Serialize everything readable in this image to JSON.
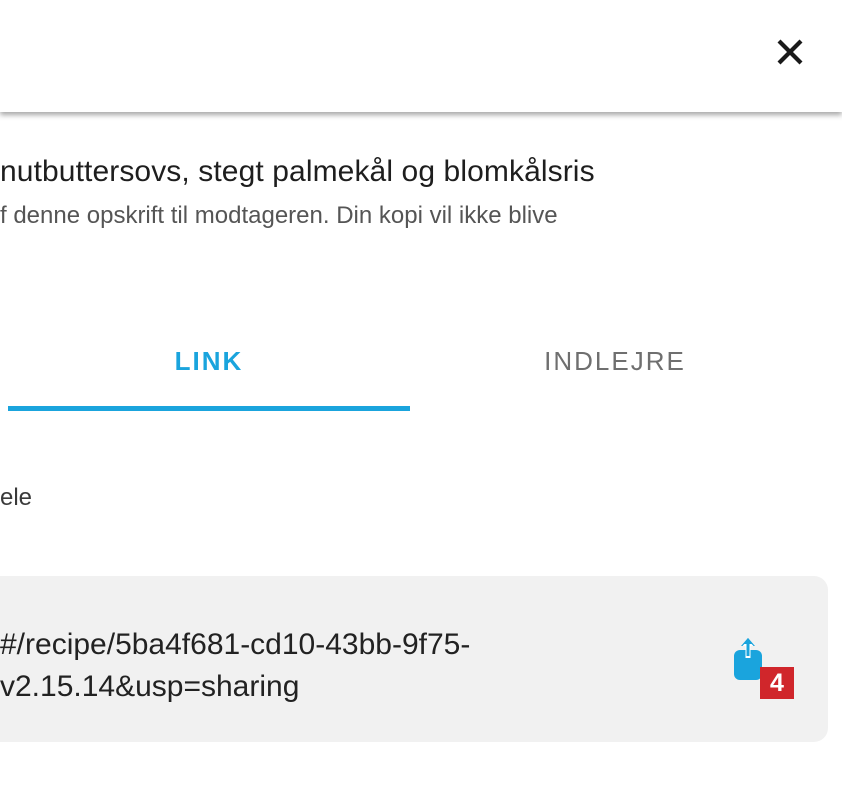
{
  "dialog": {
    "close_icon": "close-icon",
    "title": "nutbuttersovs, stegt palmekål og blomkålsris",
    "subtitle": "f denne opskrift til modtageren. Din kopi vil ikke blive"
  },
  "tabs": [
    {
      "label": "LINK",
      "active": true
    },
    {
      "label": "INDLEJRE",
      "active": false
    }
  ],
  "share": {
    "label": "ele",
    "link_line1": "#/recipe/5ba4f681-cd10-43bb-9f75-",
    "link_line2": "v2.15.14&usp=sharing",
    "share_icon": "share-icon",
    "badge": "4"
  },
  "colors": {
    "accent": "#1aa4dd",
    "badge": "#d0262b",
    "link_box": "#f1f1f1"
  }
}
